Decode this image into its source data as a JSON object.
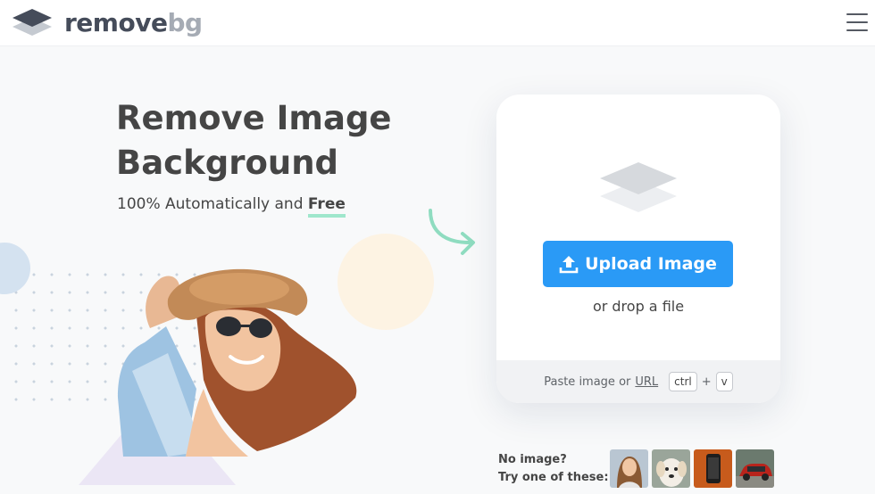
{
  "header": {
    "logo_word_1": "remove",
    "logo_word_2": "bg",
    "logo_icon": "stacked-layers-icon",
    "menu_icon": "hamburger-menu-icon"
  },
  "hero": {
    "title": "Remove Image Background",
    "subtitle_prefix": "100% Automatically and ",
    "subtitle_highlight": "Free"
  },
  "upload": {
    "button_label": "Upload Image",
    "button_icon": "upload-icon",
    "drop_text": "or drop a file",
    "paste_text": "Paste image or",
    "url_link": "URL",
    "key_ctrl": "ctrl",
    "key_plus": "+",
    "key_v": "v"
  },
  "samples": {
    "line1": "No image?",
    "line2": "Try one of these:",
    "thumbs": [
      "woman-thumbnail",
      "dog-thumbnail",
      "phone-thumbnail",
      "car-thumbnail"
    ]
  },
  "colors": {
    "accent": "#2a9af6",
    "highlight_underline": "#9fe7cc",
    "arrow": "#8fdcc0",
    "text": "#454545",
    "logo_gray": "#a5abb4"
  }
}
